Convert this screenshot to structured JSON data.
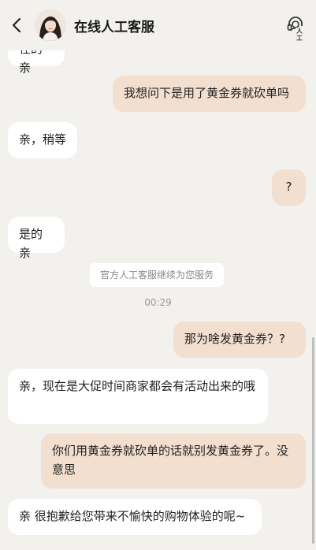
{
  "header": {
    "title": "在线人工客服",
    "agent_badge": "人工"
  },
  "messages": [
    {
      "side": "left",
      "text": "在的亲"
    },
    {
      "side": "right",
      "text": "我想问下是用了黄金券就砍单吗"
    },
    {
      "side": "left",
      "text": "亲，稍等"
    },
    {
      "side": "right",
      "text": "?"
    },
    {
      "side": "left",
      "text": "是的亲"
    },
    {
      "side": "right",
      "text": "那为啥发黄金券？?"
    },
    {
      "side": "left",
      "text": "亲，现在是大促时间商家都会有活动出来的哦"
    },
    {
      "side": "right",
      "text": "你们用黄金券就砍单的话就别发黄金券了。没意思"
    },
    {
      "side": "left",
      "text": "亲 很抱歉给您带来不愉快的购物体验的呢~"
    }
  ],
  "system_notice": "官方人工客服继续为您服务",
  "timestamp": "00:29",
  "colors": {
    "background": "#f2f1ee",
    "left_bubble": "#ffffff",
    "right_bubble": "#f3dfcf"
  }
}
